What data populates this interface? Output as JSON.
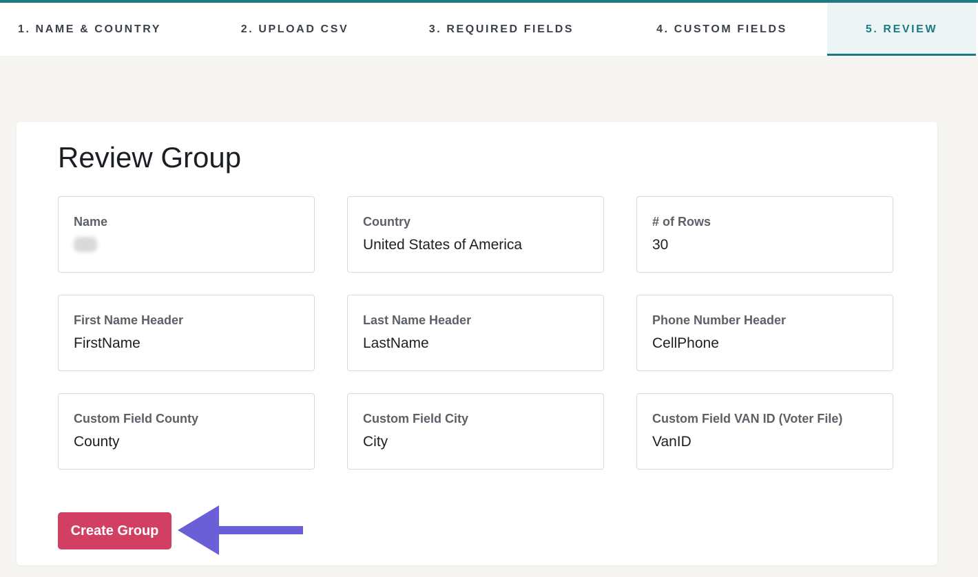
{
  "stepper": {
    "steps": [
      {
        "label": "1. NAME & COUNTRY",
        "active": false
      },
      {
        "label": "2. UPLOAD CSV",
        "active": false
      },
      {
        "label": "3. REQUIRED FIELDS",
        "active": false
      },
      {
        "label": "4. CUSTOM FIELDS",
        "active": false
      },
      {
        "label": "5. REVIEW",
        "active": true
      }
    ]
  },
  "review": {
    "title": "Review Group",
    "fields": [
      {
        "label": "Name",
        "value": ""
      },
      {
        "label": "Country",
        "value": "United States of America"
      },
      {
        "label": "# of Rows",
        "value": "30"
      },
      {
        "label": "First Name Header",
        "value": "FirstName"
      },
      {
        "label": "Last Name Header",
        "value": "LastName"
      },
      {
        "label": "Phone Number Header",
        "value": "CellPhone"
      },
      {
        "label": "Custom Field County",
        "value": "County"
      },
      {
        "label": "Custom Field City",
        "value": "City"
      },
      {
        "label": "Custom Field VAN ID (Voter File)",
        "value": "VanID"
      }
    ],
    "create_button": "Create Group"
  },
  "colors": {
    "accent": "#1a7a83",
    "button": "#d13f63",
    "annotation_arrow": "#6a5fd6"
  },
  "icons": {
    "annotation": "left-arrow-icon"
  }
}
